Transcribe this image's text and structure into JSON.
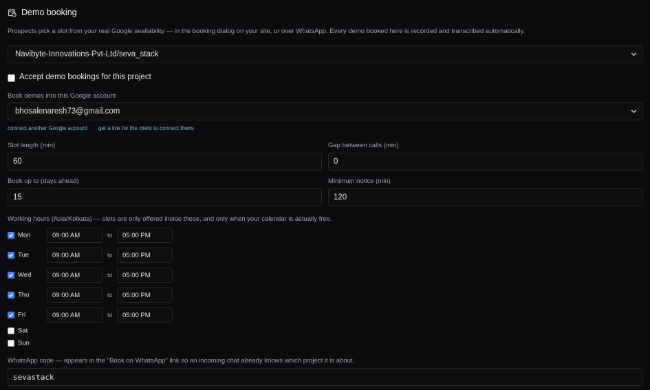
{
  "header": {
    "title": "Demo booking",
    "icon": "calendar-clock-icon"
  },
  "description": "Prospects pick a slot from your real Google availability — in the booking dialog on your site, or over WhatsApp. Every demo booked here is recorded and transcribed automatically.",
  "project_select": {
    "value": "Navibyte-Innovations-Pvt-Ltd/seva_stack"
  },
  "accept_bookings": {
    "label": "Accept demo bookings for this project",
    "checked": false
  },
  "google_account": {
    "label": "Book demos into this Google account",
    "value": "bhosalenaresh73@gmail.com",
    "connect_link": "connect another Google account",
    "client_link": "get a link for the client to connect theirs"
  },
  "slot_length": {
    "label": "Slot length (min)",
    "value": "60"
  },
  "gap_between_calls": {
    "label": "Gap between calls (min)",
    "value": "0"
  },
  "book_up_to": {
    "label": "Book up to (days ahead)",
    "value": "15"
  },
  "minimum_notice": {
    "label": "Minimum notice (min)",
    "value": "120"
  },
  "working_hours": {
    "label": "Working hours (Asia/Kolkata) — slots are only offered inside these, and only when your calendar is actually free.",
    "to_label": "to",
    "days": [
      {
        "name": "Mon",
        "enabled": true,
        "start": "09:00 AM",
        "end": "05:00 PM"
      },
      {
        "name": "Tue",
        "enabled": true,
        "start": "09:00 AM",
        "end": "05:00 PM"
      },
      {
        "name": "Wed",
        "enabled": true,
        "start": "09:00 AM",
        "end": "05:00 PM"
      },
      {
        "name": "Thu",
        "enabled": true,
        "start": "09:00 AM",
        "end": "05:00 PM"
      },
      {
        "name": "Fri",
        "enabled": true,
        "start": "09:00 AM",
        "end": "05:00 PM"
      },
      {
        "name": "Sat",
        "enabled": false
      },
      {
        "name": "Sun",
        "enabled": false
      }
    ]
  },
  "whatsapp_code": {
    "label": "WhatsApp code — appears in the \"Book on WhatsApp\" link so an incoming chat already knows which project it is about.",
    "value": "sevastack"
  },
  "colors": {
    "background": "#0c0c0e",
    "accent": "#3b82f6",
    "link": "#7dbbd2"
  }
}
